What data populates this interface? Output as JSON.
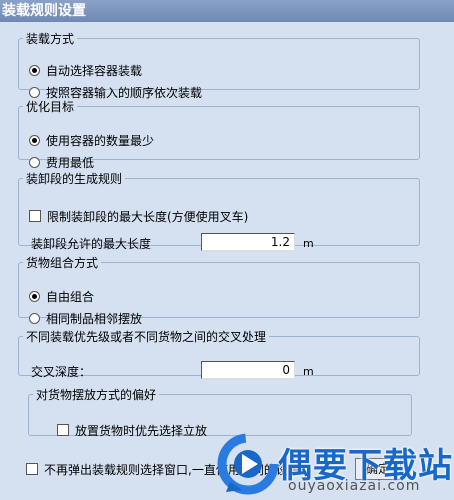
{
  "window": {
    "title": "装载规则设置"
  },
  "loading_mode": {
    "legend": "装载方式",
    "options": [
      "自动选择容器装载",
      "按照容器输入的顺序依次装载"
    ],
    "selected": 0
  },
  "optimization": {
    "legend": "优化目标",
    "options": [
      "使用容器的数量最少",
      "费用最低"
    ],
    "selected": 0
  },
  "segment_rule": {
    "legend": "装卸段的生成规则",
    "limit_label": "限制装卸段的最大长度(方便使用叉车)",
    "limit_checked": false,
    "max_length_label": "装卸段允许的最大长度",
    "max_length_value": "1.2",
    "unit": "m"
  },
  "cargo_combo": {
    "legend": "货物组合方式",
    "options": [
      "自由组合",
      "相同制品相邻摆放"
    ],
    "selected": 0
  },
  "cross_handling": {
    "legend": "不同装载优先级或者不同货物之间的交叉处理",
    "depth_label": "交叉深度：",
    "depth_value": "0",
    "unit": "m"
  },
  "placement_pref": {
    "legend": "对货物摆放方式的偏好",
    "upright_label": "放置货物时优先选择立放",
    "upright_checked": false
  },
  "footer": {
    "no_popup_label": "不再弹出装载规则选择窗口,一直使用相同的设置",
    "no_popup_checked": false,
    "ok_label": "确定"
  },
  "watermark": {
    "name": "偶要下载站",
    "url": "ouyaoxiazai.com"
  }
}
